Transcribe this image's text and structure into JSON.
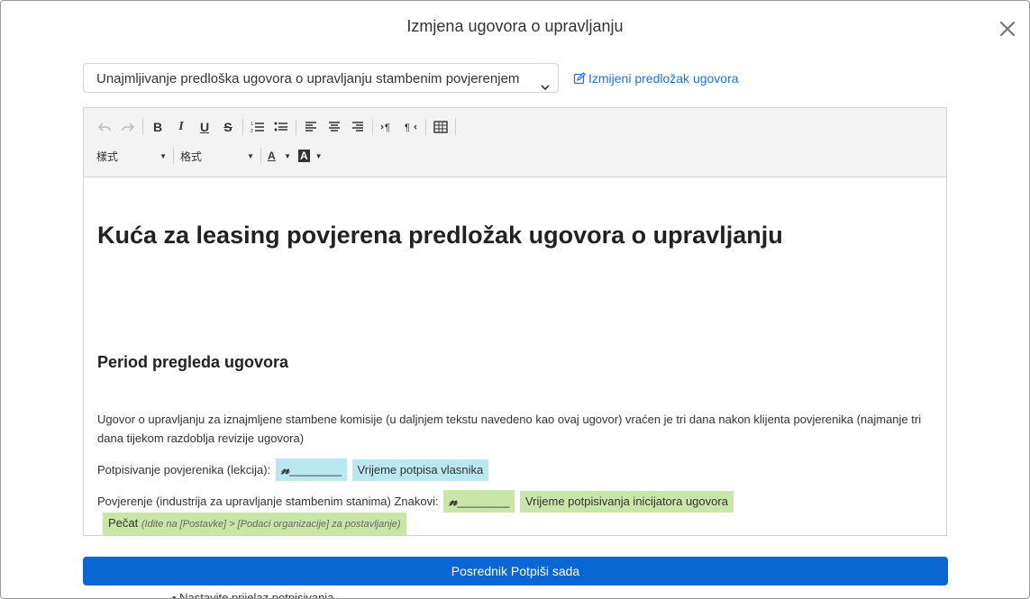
{
  "modal": {
    "title": "Izmjena ugovora o upravljanju"
  },
  "template_select": {
    "value": "Unajmljivanje predloška ugovora o upravljanju stambenim povjerenjem"
  },
  "edit_template_link": "Izmijeni predložak ugovora",
  "toolbar": {
    "bold": "B",
    "italic": "I",
    "underline": "U",
    "strike": "S",
    "style_dropdown": "樣式",
    "format_dropdown": "格式",
    "font_color": "A",
    "bg_color": "A"
  },
  "document": {
    "title": "Kuća za leasing povjerena predložak ugovora o upravljanju",
    "section_heading": "Period pregleda ugovora",
    "paragraph": "Ugovor o upravljanju za iznajmljene stambene komisije (u daljnjem tekstu navedeno kao ovaj ugovor) vraćen je tri dana nakon klijenta povjerenika (najmanje tri dana tijekom razdoblja revizije ugovora)",
    "line1": {
      "label": "Potpisivanje povjerenika (lekcija):",
      "sig": "𝓃",
      "sig_line": "________",
      "time": "Vrijeme potpisa vlasnika"
    },
    "line2": {
      "label": "Povjerenje (industrija za upravljanje stambenim stanima) Znakovi:",
      "sig": "𝓃",
      "sig_line": "________",
      "time": "Vrijeme potpisivanja inicijatora ugovora",
      "seal": "Pečat",
      "seal_hint": "(Idite na [Postavke] > [Podaci organizacije] za postavljanje)"
    }
  },
  "sign_button": "Posrednik Potpiši sada",
  "below_text": "• Nastavite prijelaz potpisivanja"
}
